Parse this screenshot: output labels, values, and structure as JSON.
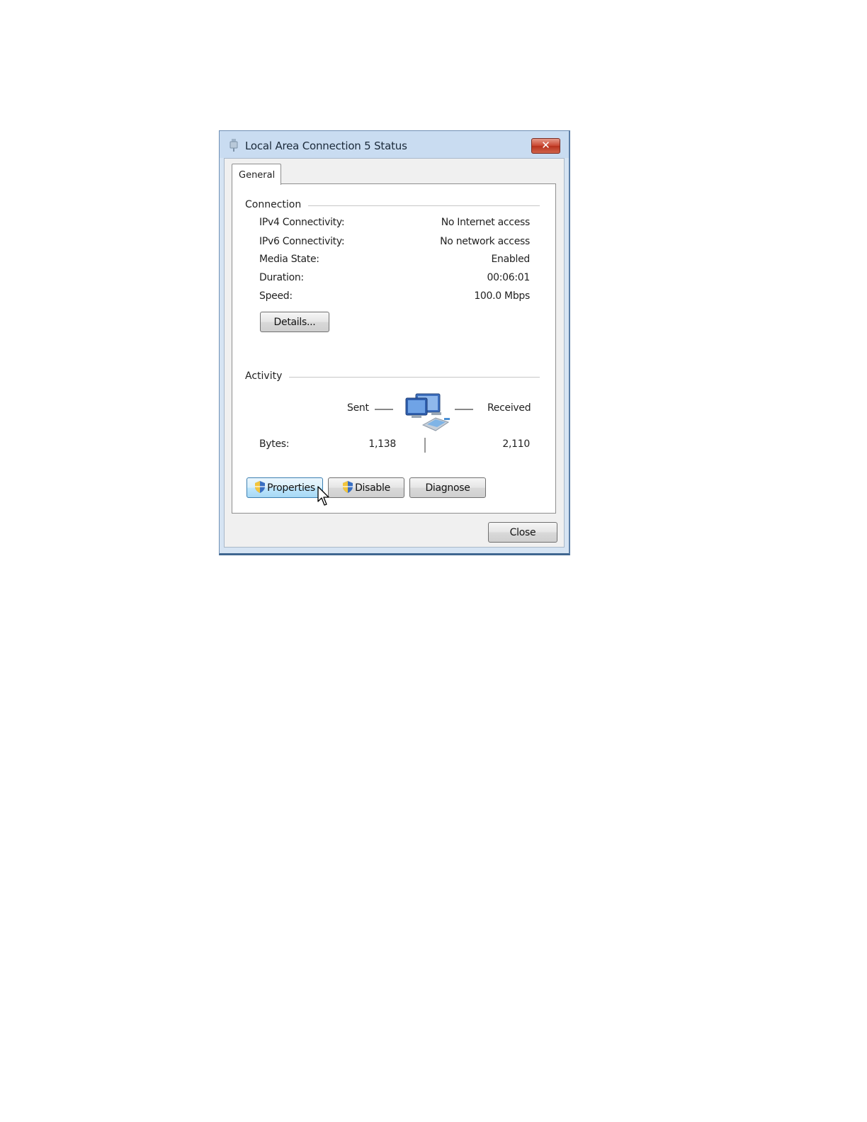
{
  "window": {
    "title": "Local Area Connection 5 Status",
    "close_glyph": "✕"
  },
  "tabs": [
    {
      "label": "General"
    }
  ],
  "connection": {
    "heading": "Connection",
    "rows": [
      {
        "label": "IPv4 Connectivity:",
        "value": "No Internet access"
      },
      {
        "label": "IPv6 Connectivity:",
        "value": "No network access"
      },
      {
        "label": "Media State:",
        "value": "Enabled"
      },
      {
        "label": "Duration:",
        "value": "00:06:01"
      },
      {
        "label": "Speed:",
        "value": "100.0 Mbps"
      }
    ],
    "details_button": "Details..."
  },
  "activity": {
    "heading": "Activity",
    "sent_label": "Sent",
    "received_label": "Received",
    "bytes_label": "Bytes:",
    "bytes_sent": "1,138",
    "bytes_received": "2,110"
  },
  "buttons": {
    "properties": "Properties",
    "disable": "Disable",
    "diagnose": "Diagnose",
    "close": "Close"
  },
  "colors": {
    "title_bar": "#c9dcf1",
    "close_button": "#c8452f",
    "hot_button": "#bee6fd"
  },
  "icons": {
    "title": "network-adapter-icon",
    "activity": "network-computers-icon",
    "uac": "uac-shield-icon",
    "pointer": "mouse-cursor-icon"
  }
}
